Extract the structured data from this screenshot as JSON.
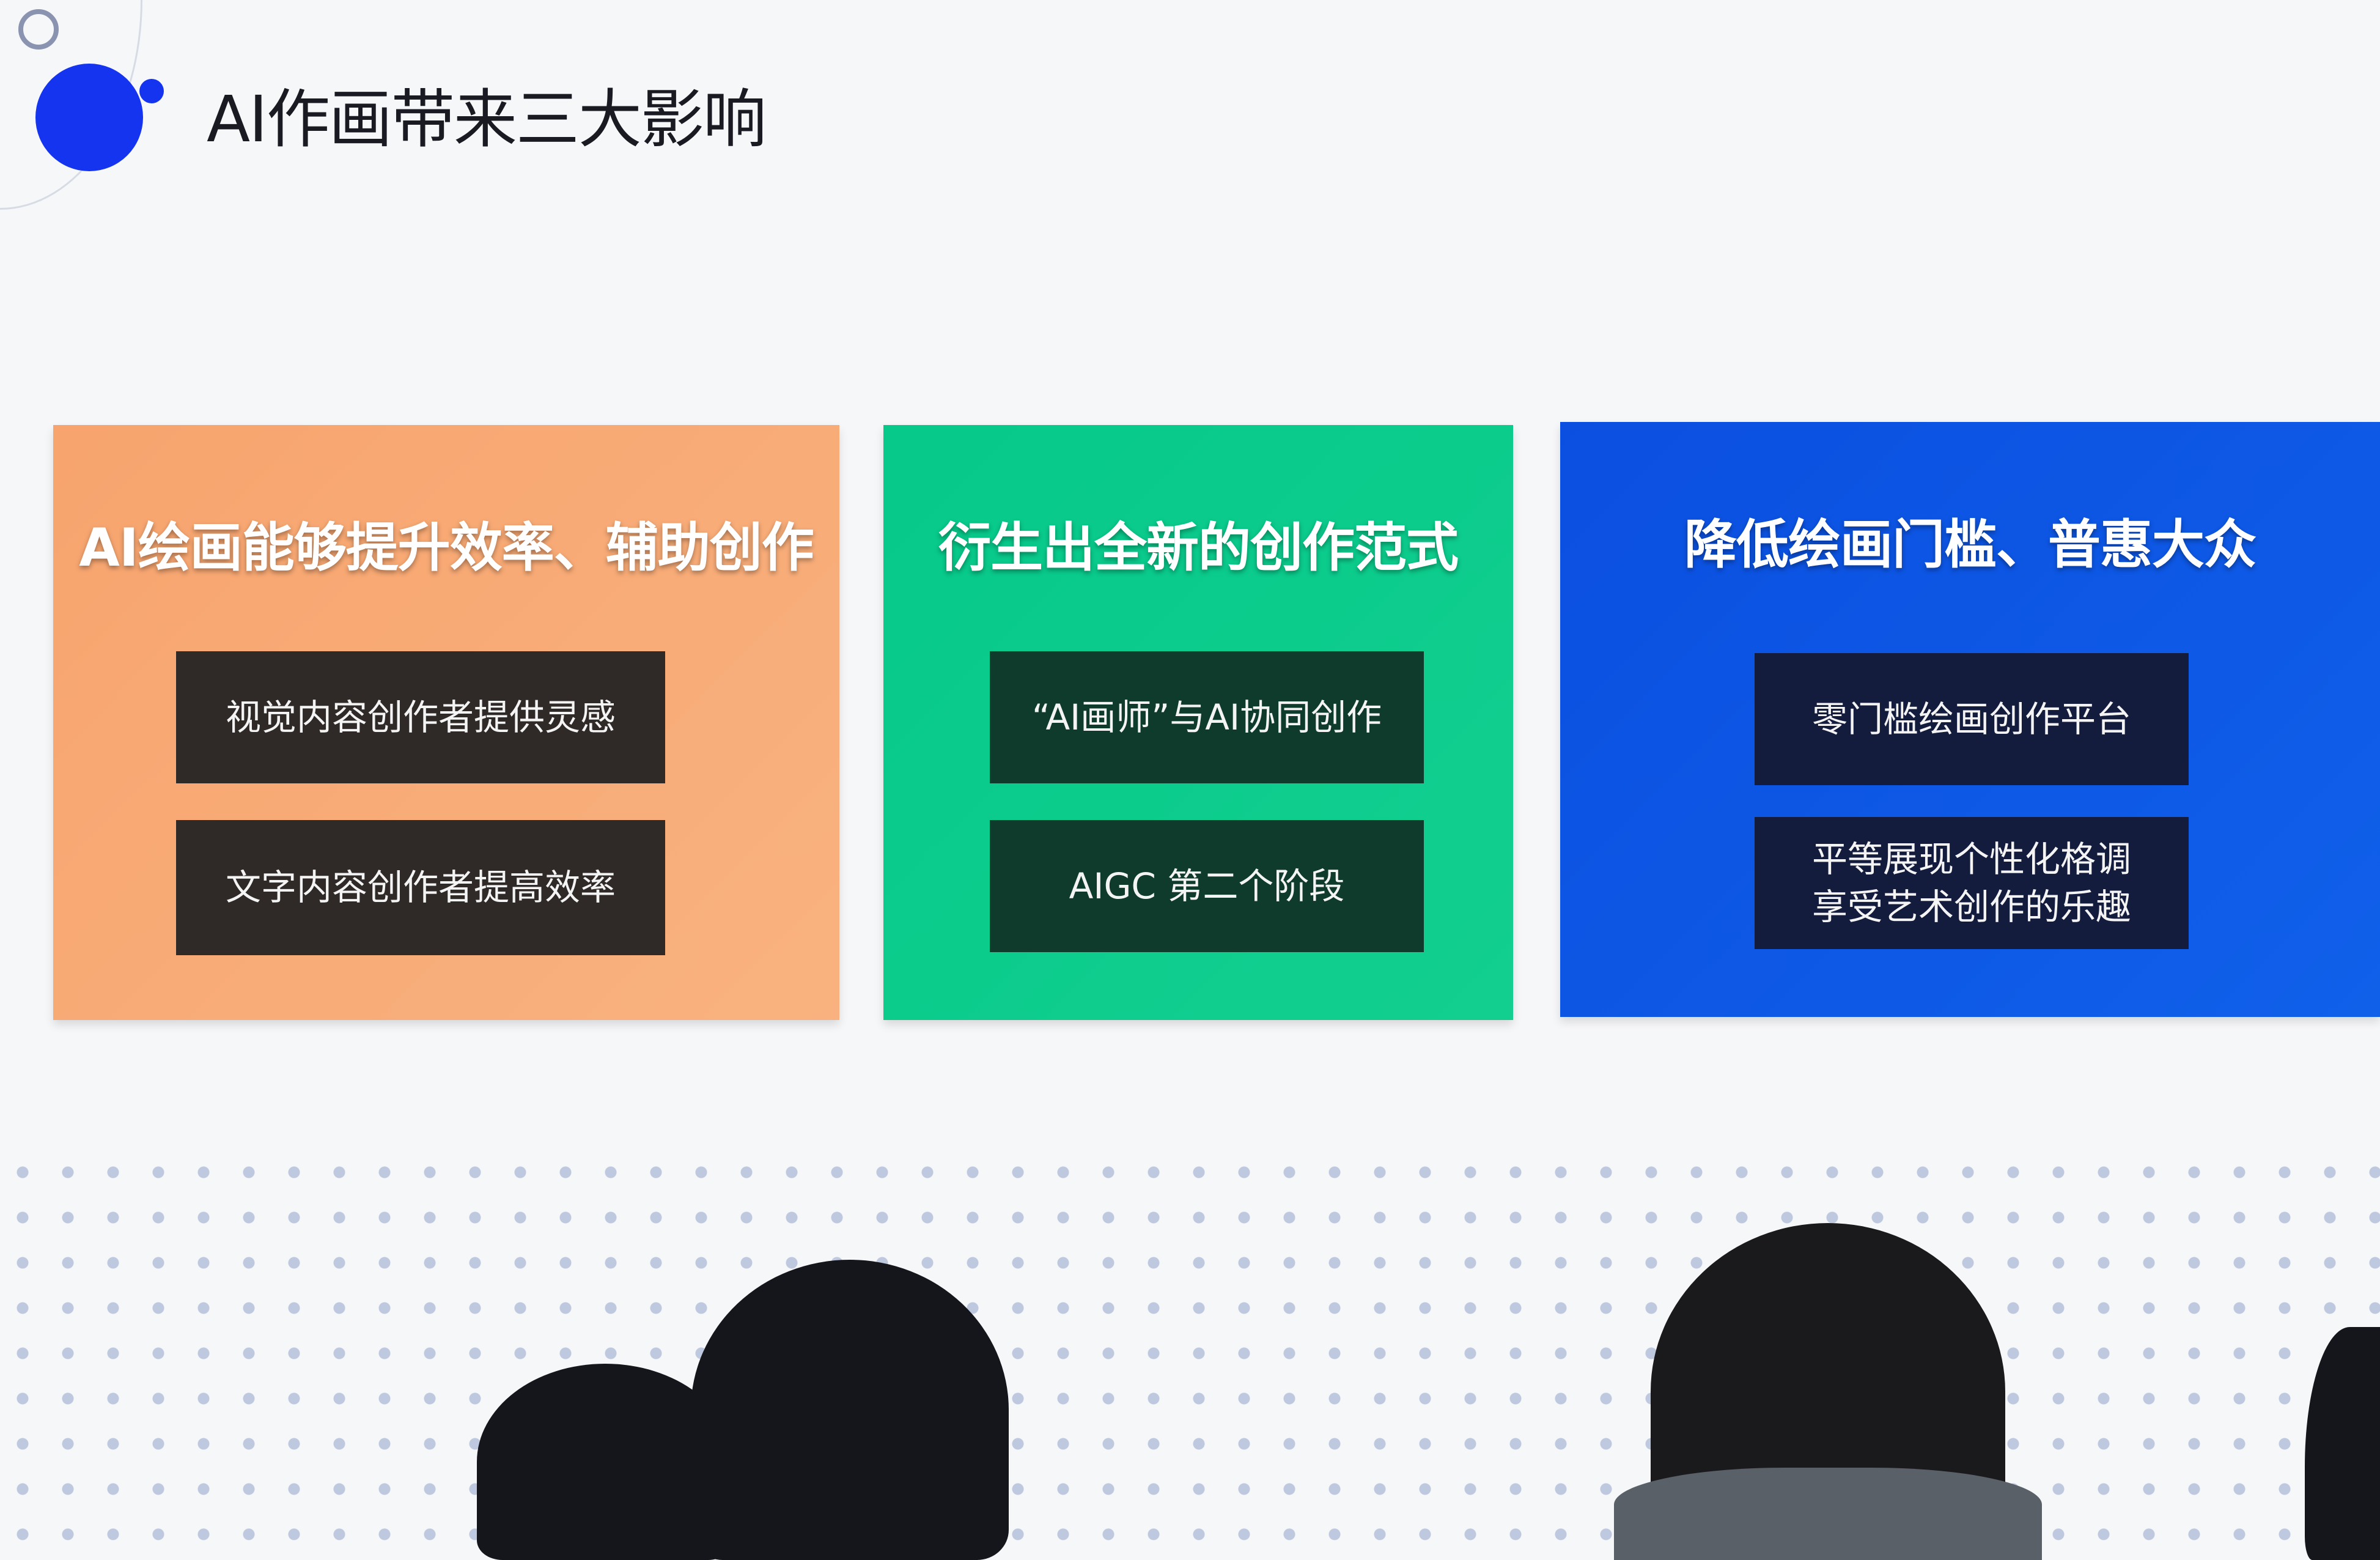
{
  "slide": {
    "title": "AI作画带来三大影响",
    "colors": {
      "accent": "#1434f0",
      "orange": "#f7a772",
      "green": "#08c889",
      "blue": "#0a4fe0"
    },
    "cards": [
      {
        "heading": "AI绘画能够提升效率、辅助创作",
        "items": [
          "视觉内容创作者提供灵感",
          "文字内容创作者提高效率"
        ]
      },
      {
        "heading": "衍生出全新的创作范式",
        "items": [
          "“AI画师”与AI协同创作",
          "AIGC 第二个阶段"
        ]
      },
      {
        "heading": "降低绘画门槛、普惠大众",
        "items": [
          "零门槛绘画创作平台",
          "平等展现个性化格调\n享受艺术创作的乐趣"
        ]
      }
    ]
  }
}
